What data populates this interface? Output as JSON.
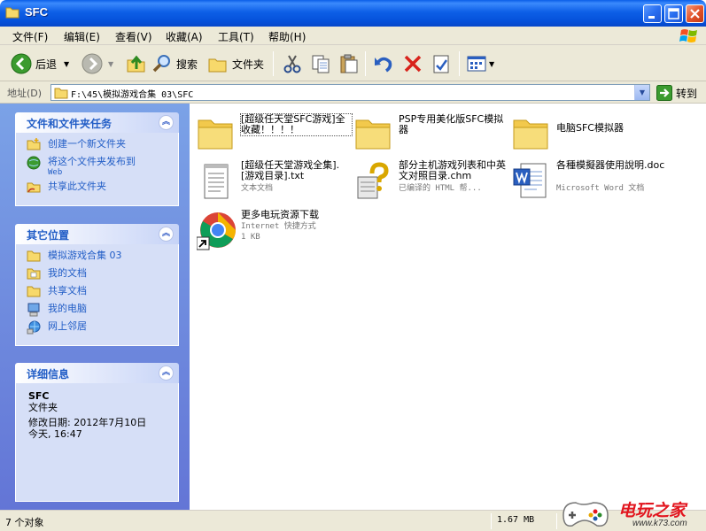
{
  "window": {
    "title": "SFC"
  },
  "menu": [
    "文件(F)",
    "编辑(E)",
    "查看(V)",
    "收藏(A)",
    "工具(T)",
    "帮助(H)"
  ],
  "toolbar": {
    "back": "后退",
    "search": "搜索",
    "folders": "文件夹"
  },
  "address": {
    "label": "地址(D)",
    "value": "F:\\45\\模拟游戏合集 03\\SFC",
    "go": "转到"
  },
  "tasks": {
    "title": "文件和文件夹任务",
    "items": [
      {
        "label": "创建一个新文件夹",
        "icon": "new-folder-icon"
      },
      {
        "label": "将这个文件夹发布到",
        "sub": "Web",
        "icon": "publish-web-icon"
      },
      {
        "label": "共享此文件夹",
        "icon": "share-folder-icon"
      }
    ]
  },
  "places": {
    "title": "其它位置",
    "items": [
      {
        "label": "模拟游戏合集 03",
        "icon": "folder-icon"
      },
      {
        "label": "我的文档",
        "icon": "my-documents-icon"
      },
      {
        "label": "共享文档",
        "icon": "shared-documents-icon"
      },
      {
        "label": "我的电脑",
        "icon": "my-computer-icon"
      },
      {
        "label": "网上邻居",
        "icon": "network-places-icon"
      }
    ]
  },
  "details": {
    "title": "详细信息",
    "name": "SFC",
    "type": "文件夹",
    "modified": "修改日期: 2012年7月10日",
    "time": "今天, 16:47"
  },
  "files": [
    {
      "name": "[超级任天堂SFC游戏]全收藏！！！！",
      "meta1": "",
      "meta2": "",
      "icon": "folder-icon"
    },
    {
      "name": "PSP专用美化版SFC模拟器",
      "meta1": "",
      "meta2": "",
      "icon": "folder-icon"
    },
    {
      "name": "电脑SFC模拟器",
      "meta1": "",
      "meta2": "",
      "icon": "folder-icon"
    },
    {
      "name": "[超级任天堂游戏全集].[游戏目录].txt",
      "meta1": "文本文档",
      "meta2": "",
      "icon": "text-file-icon"
    },
    {
      "name": "部分主机游戏列表和中英文对照目录.chm",
      "meta1": "已编译的 HTML 帮...",
      "meta2": "",
      "icon": "chm-help-icon"
    },
    {
      "name": "各種模擬器使用說明.doc",
      "meta1": "Microsoft Word 文档",
      "meta2": "",
      "icon": "word-doc-icon"
    },
    {
      "name": "更多电玩资源下载",
      "meta1": "Internet 快捷方式",
      "meta2": "1 KB",
      "icon": "chrome-shortcut-icon"
    }
  ],
  "status": {
    "count": "7 个对象",
    "size": "1.67 MB"
  },
  "watermark": {
    "title": "电玩之家",
    "url": "www.k73.com"
  }
}
